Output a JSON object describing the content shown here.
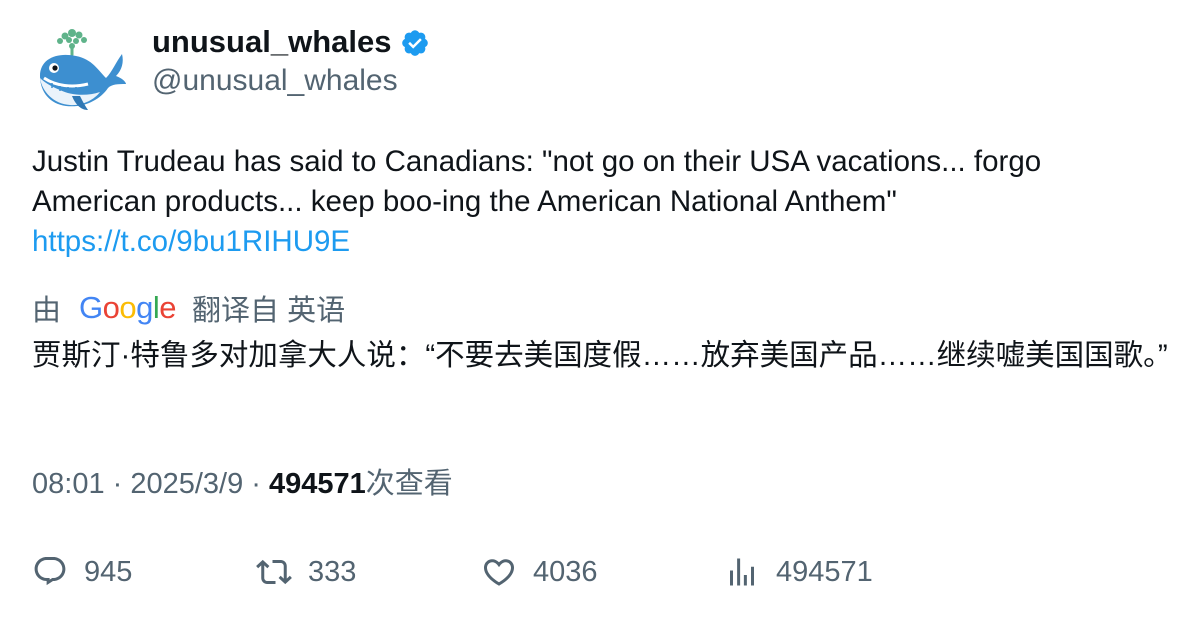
{
  "author": {
    "display_name": "unusual_whales",
    "handle": "@unusual_whales",
    "verified": true,
    "avatar_icon": "whale-avatar-icon"
  },
  "tweet": {
    "text": "Justin Trudeau has said to Canadians: \"not go on their USA vacations... forgo American products... keep boo-ing the American National Anthem\"",
    "link": "https://t.co/9bu1RIHU9E"
  },
  "translation": {
    "prefix": "由",
    "provider": "Google",
    "suffix": "翻译自 英语",
    "text": "贾斯汀·特鲁多对加拿大人说：“不要去美国度假……放弃美国产品……继续嘘美国国歌。”"
  },
  "meta": {
    "time": "08:01 · 2025/3/9 · ",
    "views_count": "494571",
    "views_label": "次查看"
  },
  "actions": {
    "replies": "945",
    "reposts": "333",
    "likes": "4036",
    "views": "494571"
  },
  "colors": {
    "text": "#0f1419",
    "secondary": "#536471",
    "link": "#1d9bf0",
    "verified": "#1d9bf0"
  }
}
